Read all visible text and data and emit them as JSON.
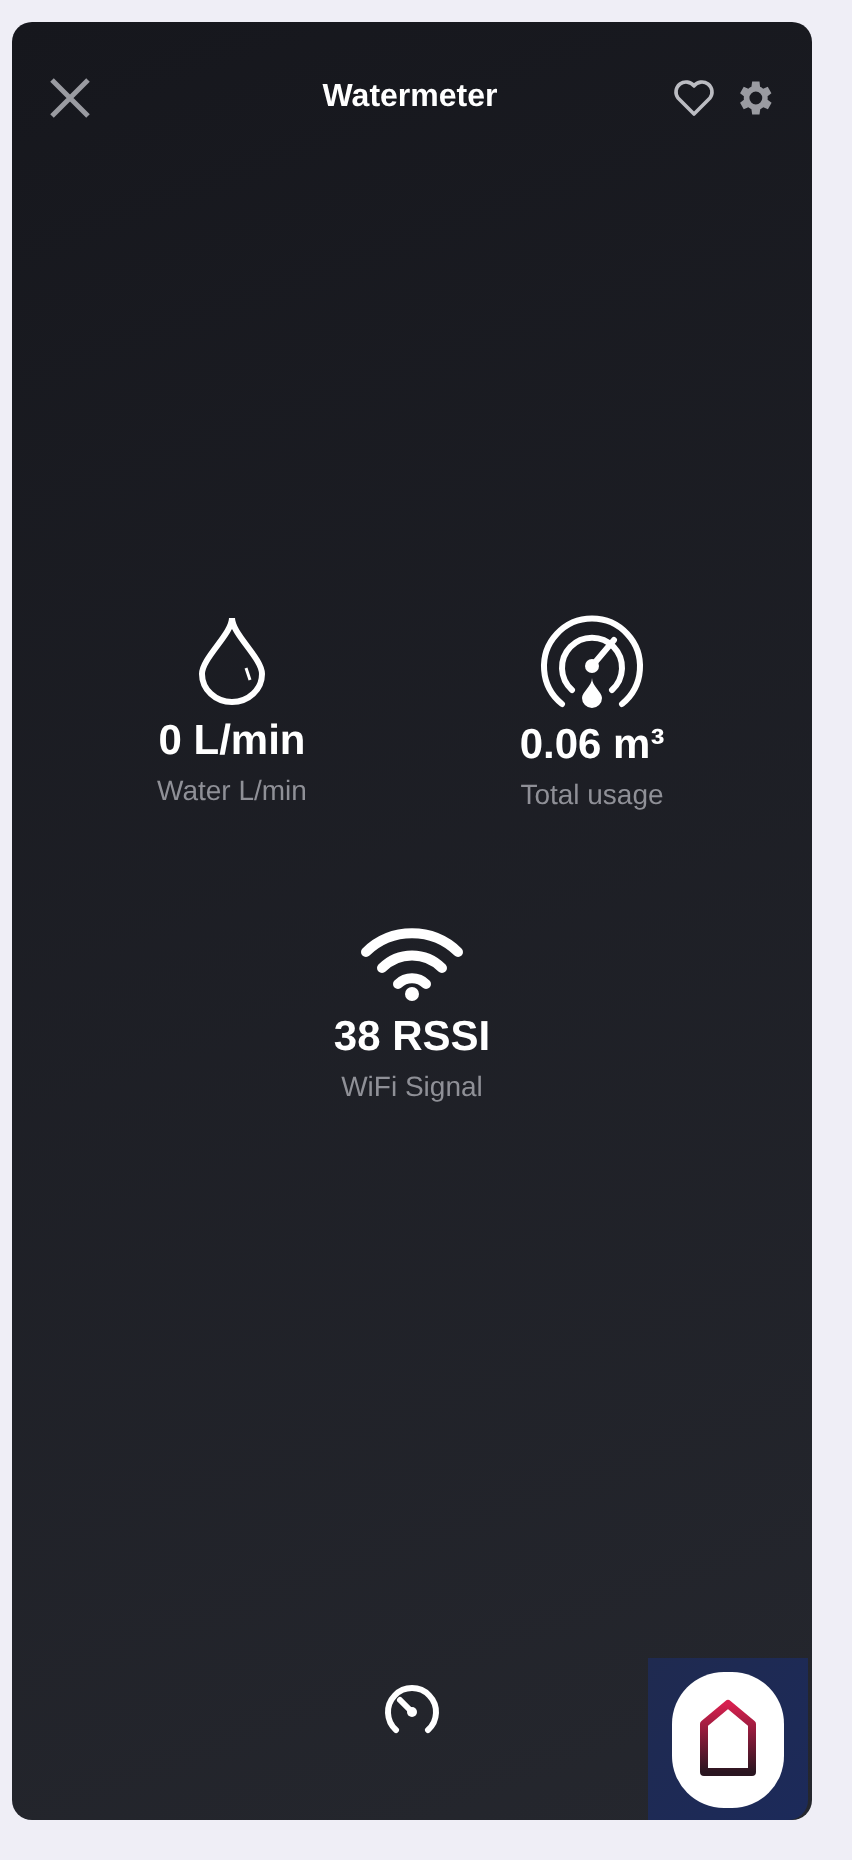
{
  "header": {
    "title": "Watermeter",
    "favorite": false
  },
  "sensors": [
    {
      "kind": "drop",
      "value": "0 L/min",
      "label": "Water L/min"
    },
    {
      "kind": "gauge",
      "value": "0.06 m³",
      "label": "Total usage"
    },
    {
      "kind": "wifi",
      "value": "38 RSSI",
      "label": "WiFi Signal"
    }
  ]
}
